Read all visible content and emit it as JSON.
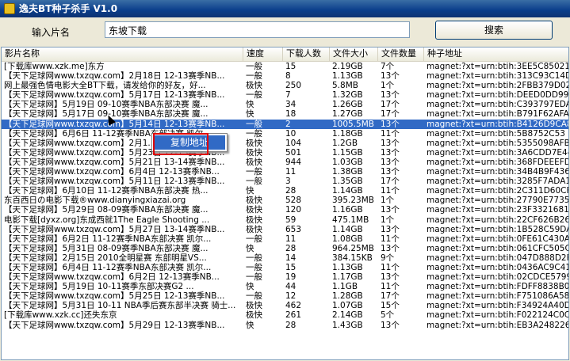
{
  "window": {
    "title": "逸夫BT种子杀手 V1.0"
  },
  "search": {
    "label": "输入片名",
    "value": "东坡下载",
    "button": "搜索"
  },
  "columns": [
    "影片名称",
    "速度",
    "下载人数",
    "文件大小",
    "文件数量",
    "种子地址"
  ],
  "context_menu": {
    "item": "复制地址"
  },
  "colors": {
    "selection": "#316ac5",
    "annotation": "#e00000"
  },
  "rows": [
    [
      "[下载库www.xzk.me]东方",
      "一般",
      "15",
      "2.19GB",
      "7个",
      "magnet:?xt=urn:btih:3EE5C85021"
    ],
    [
      "【天下足球网www.txzqw.com】2月18日 12-13赛季NB...",
      "一般",
      "8",
      "1.13GB",
      "13个",
      "magnet:?xt=urn:btih:313C93C14D"
    ],
    [
      "网上最强色情电影大全BT下载，请发给你的好友，好...",
      "极快",
      "250",
      "5.8MB",
      "1个",
      "magnet:?xt=urn:btih:2FBB379D02"
    ],
    [
      "【天下足球网www.txzqw.com】5月17日 12-13赛季NB...",
      "一般",
      "7",
      "1.32GB",
      "13个",
      "magnet:?xt=urn:btih:DEED0DD998"
    ],
    [
      "【天下足球网】5月19日 09-10赛季NBA东部决赛 魔...",
      "快",
      "34",
      "1.26GB",
      "17个",
      "magnet:?xt=urn:btih:C393797EDA"
    ],
    [
      "【天下足球网】5月17日 09-10赛季NBA东部决赛 魔...",
      "快",
      "18",
      "1.27GB",
      "17个",
      "magnet:?xt=urn:btih:B791F62AFA"
    ],
    [
      "【天下足球网www.txzqw.com】5月14日 12-13赛季NB...",
      "一般",
      "2",
      "1005.5MB",
      "13个",
      "magnet:?xt=urn:btih:B4126D9CA8"
    ],
    [
      "【天下足球网】6月6日 11-12赛季NBA东部决赛 凯尔...",
      "一般",
      "10",
      "1.18GB",
      "11个",
      "magnet:?xt=urn:btih:5B8752C53"
    ],
    [
      "【天下足球网www.txzqw.com】2月1...",
      "极快",
      "104",
      "1.2GB",
      "13个",
      "magnet:?xt=urn:btih:5355098AFB"
    ],
    [
      "【天下足球网www.txzqw.com】5月23日 12-13赛季NB...",
      "极快",
      "501",
      "1.15GB",
      "13个",
      "magnet:?xt=urn:btih:3A6CDD7E44"
    ],
    [
      "【天下足球网www.txzqw.com】5月21日 13-14赛季NB...",
      "极快",
      "944",
      "1.03GB",
      "13个",
      "magnet:?xt=urn:btih:368FDEEEFD"
    ],
    [
      "【天下足球网www.txzqw.com】6月4日 12-13赛季NB...",
      "一般",
      "11",
      "1.38GB",
      "13个",
      "magnet:?xt=urn:btih:34B4B9F436"
    ],
    [
      "【天下足球网www.txzqw.com】5月11日 12-13赛季NB...",
      "一般",
      "3",
      "1.35GB",
      "17个",
      "magnet:?xt=urn:btih:3285F7ADA1"
    ],
    [
      "【天下足球网】6月10日 11-12赛季NBA东部决赛 热...",
      "快",
      "28",
      "1.14GB",
      "11个",
      "magnet:?xt=urn:btih:2C311D60CF"
    ],
    [
      "东百西日の电影下载®www.dianyingxiazai.org",
      "极快",
      "528",
      "395.23MB",
      "1个",
      "magnet:?xt=urn:btih:27790E7735"
    ],
    [
      "【天下足球网】5月29日 08-09赛季NBA东部决赛 魔...",
      "极快",
      "120",
      "1.16GB",
      "13个",
      "magnet:?xt=urn:btih:23F3321681"
    ],
    [
      "电影下载[dyxz.org]东成西就1The Eagle Shooting ...",
      "极快",
      "59",
      "475.1MB",
      "1个",
      "magnet:?xt=urn:btih:22CF626B26"
    ],
    [
      "【天下足球网www.txzqw.com】5月27日 13-14赛季NB...",
      "极快",
      "653",
      "1.14GB",
      "13个",
      "magnet:?xt=urn:btih:1B528C59DA"
    ],
    [
      "【天下足球网】6月2日 11-12赛季NBA东部决赛 凯尔...",
      "一般",
      "11",
      "1.08GB",
      "11个",
      "magnet:?xt=urn:btih:0FE61C430A"
    ],
    [
      "【天下足球网】5月31日 08-09赛季NBA东部决赛 魔...",
      "快",
      "28",
      "964.25MB",
      "13个",
      "magnet:?xt=urn:btih:061CFC505C"
    ],
    [
      "【天下足球网】2月15日 2010全明星赛 东部明星VS...",
      "一般",
      "14",
      "384.15KB",
      "9个",
      "magnet:?xt=urn:btih:047D888D2F"
    ],
    [
      "【天下足球网】6月4日 11-12赛季NBA东部决赛 凯尔...",
      "一般",
      "15",
      "1.13GB",
      "11个",
      "magnet:?xt=urn:btih:0436AC9C41"
    ],
    [
      "【天下足球网www.txzqw.com】6月2日 12-13赛季NB...",
      "一般",
      "19",
      "1.17GB",
      "13个",
      "magnet:?xt=urn:btih:02CDCE5799"
    ],
    [
      "【天下足球网】5月19日 10-11赛季东部决赛G2 ...",
      "快",
      "44",
      "1.1GB",
      "11个",
      "magnet:?xt=urn:btih:FDFF8838B0"
    ],
    [
      "【天下足球网www.txzqw.com】5月25日 12-13赛季NB...",
      "一般",
      "12",
      "1.28GB",
      "17个",
      "magnet:?xt=urn:btih:F751086A58"
    ],
    [
      "【天下足球网】5月31日 10-11 NBA季后赛东部半决赛 骑士...",
      "极快",
      "462",
      "1.07GB",
      "15个",
      "magnet:?xt=urn:btih:F34924A40D"
    ],
    [
      "[下载库www.xzk.cc]还失东京",
      "极快",
      "261",
      "2.14GB",
      "5个",
      "magnet:?xt=urn:btih:F022124C0C"
    ],
    [
      "【天下足球网www.txzqw.com】5月29日 12-13赛季NB...",
      "快",
      "28",
      "1.43GB",
      "13个",
      "magnet:?xt=urn:btih:EB3A248226"
    ]
  ],
  "selected_row": 6
}
